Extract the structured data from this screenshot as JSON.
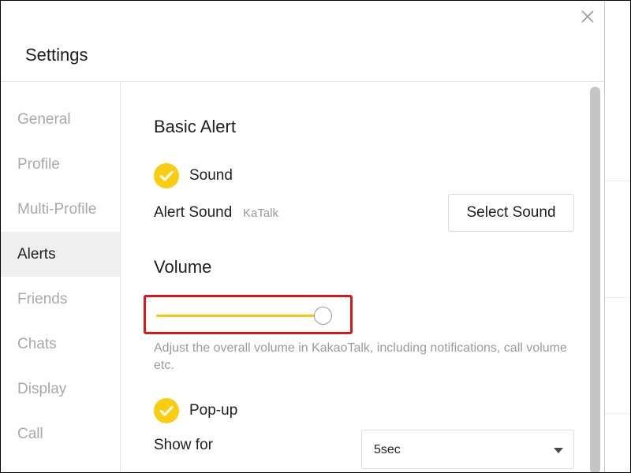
{
  "dialog": {
    "title": "Settings"
  },
  "sidebar": {
    "items": [
      {
        "label": "General",
        "active": false
      },
      {
        "label": "Profile",
        "active": false
      },
      {
        "label": "Multi-Profile",
        "active": false
      },
      {
        "label": "Alerts",
        "active": true
      },
      {
        "label": "Friends",
        "active": false
      },
      {
        "label": "Chats",
        "active": false
      },
      {
        "label": "Display",
        "active": false
      },
      {
        "label": "Call",
        "active": false
      }
    ]
  },
  "alerts": {
    "basic_alert_heading": "Basic Alert",
    "sound": {
      "label": "Sound",
      "checked": true
    },
    "alert_sound": {
      "label": "Alert Sound",
      "value": "KaTalk",
      "button_label": "Select Sound"
    },
    "volume": {
      "heading": "Volume",
      "level": 1.0,
      "help_text": "Adjust the overall volume in KakaoTalk, including notifications, call volume etc."
    },
    "popup": {
      "label": "Pop-up",
      "checked": true
    },
    "show_for": {
      "label": "Show for",
      "selected": "5sec"
    }
  },
  "colors": {
    "accent": "#f9ce10",
    "highlight": "#d6191c",
    "active_bg": "#efefef",
    "muted_text": "#a8a8a8"
  }
}
